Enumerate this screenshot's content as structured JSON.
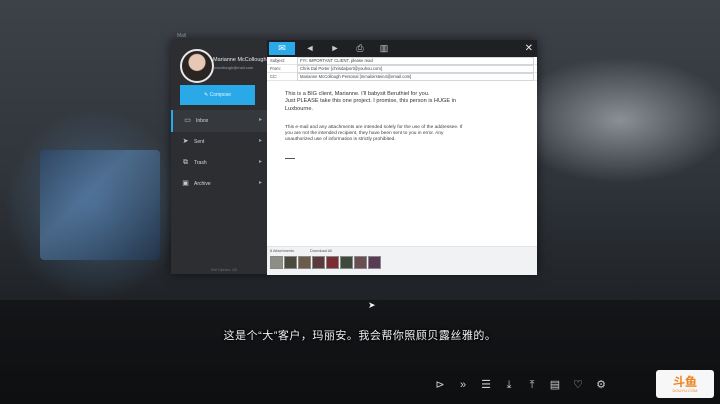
{
  "window": {
    "title": "Mail"
  },
  "user": {
    "name": "Marianne McCollough",
    "email": "mccollough@mail.com"
  },
  "sidebar": {
    "compose_label": "Compose",
    "items": [
      {
        "label": "Inbox",
        "icon": "inbox-icon"
      },
      {
        "label": "Sent",
        "icon": "sent-icon"
      },
      {
        "label": "Trash",
        "icon": "trash-icon"
      },
      {
        "label": "Archive",
        "icon": "archive-icon"
      }
    ],
    "footer": "Self Opinion: 4/5"
  },
  "toolbar": {
    "buttons": [
      "mail-icon",
      "reply-icon",
      "forward-icon",
      "print-icon",
      "delete-icon"
    ],
    "close": "✕"
  },
  "email": {
    "subject_label": "Subject:",
    "subject": "FYI: IMPORTANT CLIENT, please read",
    "from_label": "From:",
    "from": "Chris Dal Porter [chrisdalport@youhou.com]",
    "cc_label": "CC:",
    "cc": "Marianne McCollough Personal [mmaloirstein4@email.com]",
    "body_lines": [
      "This is a BIG client, Marianne. I'll babysit Beruthiel for you.",
      "Just PLEASE take this one project. I promise, this person is HUGE in",
      "Luxbourne."
    ],
    "legal_lines": [
      "This e-mail and any attachments are intended solely for the use of the addressee. If",
      "you are not the intended recipient, they have been sent to you in error. Any",
      "unauthorized use of information is strictly prohibited."
    ],
    "attachments_label": "8 Attachments",
    "download_all": "Download All",
    "attachment_count": 8
  },
  "subtitle": "这是个“大”客户，玛丽安。我会帮你照顾贝露丝雅的。",
  "game_controls": [
    "skip-back-icon",
    "fast-forward-icon",
    "history-icon",
    "save-icon",
    "load-icon",
    "quick-save-icon",
    "favorite-icon",
    "settings-icon"
  ],
  "watermark": {
    "mark": "斗鱼",
    "sub": "DOUYU.COM"
  },
  "colors": {
    "accent": "#29a9e7",
    "sidebar": "#2c2e32",
    "logo": "#f08019"
  }
}
